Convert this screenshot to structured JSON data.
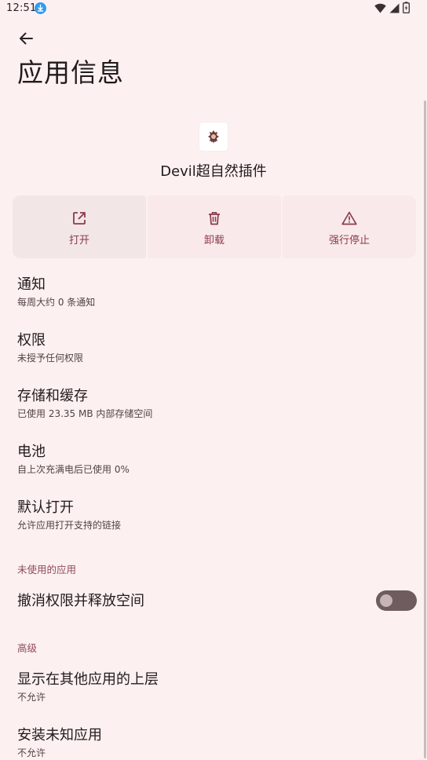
{
  "status_bar": {
    "time": "12:51",
    "notification_icon": "download-badge-icon",
    "icons": [
      "wifi-icon",
      "signal-icon",
      "battery-icon"
    ]
  },
  "header": {
    "title": "应用信息",
    "back_icon": "arrow-back-icon"
  },
  "app": {
    "name": "Devil超自然插件",
    "icon": "app-icon"
  },
  "actions": [
    {
      "label": "打开",
      "icon": "open-external-icon"
    },
    {
      "label": "卸载",
      "icon": "trash-icon"
    },
    {
      "label": "强行停止",
      "icon": "warning-icon"
    }
  ],
  "items": {
    "notifications": {
      "title": "通知",
      "summary": "每周大约 0 条通知"
    },
    "permissions": {
      "title": "权限",
      "summary": "未授予任何权限"
    },
    "storage": {
      "title": "存储和缓存",
      "summary": "已使用 23.35 MB 内部存储空间"
    },
    "battery": {
      "title": "电池",
      "summary": "自上次充满电后已使用 0%"
    },
    "open_by_default": {
      "title": "默认打开",
      "summary": "允许应用打开支持的链接"
    }
  },
  "unused_apps": {
    "header": "未使用的应用",
    "remove_permissions": {
      "title": "撤消权限并释放空间",
      "enabled": false
    }
  },
  "advanced": {
    "header": "高级",
    "display_over": {
      "title": "显示在其他应用的上层",
      "summary": "不允许"
    },
    "install_unknown": {
      "title": "安装未知应用",
      "summary": "不允许"
    }
  },
  "colors": {
    "background": "#fcf0f0",
    "accent": "#8a3b4b",
    "text_primary": "#221a1b",
    "text_secondary": "#524345"
  }
}
